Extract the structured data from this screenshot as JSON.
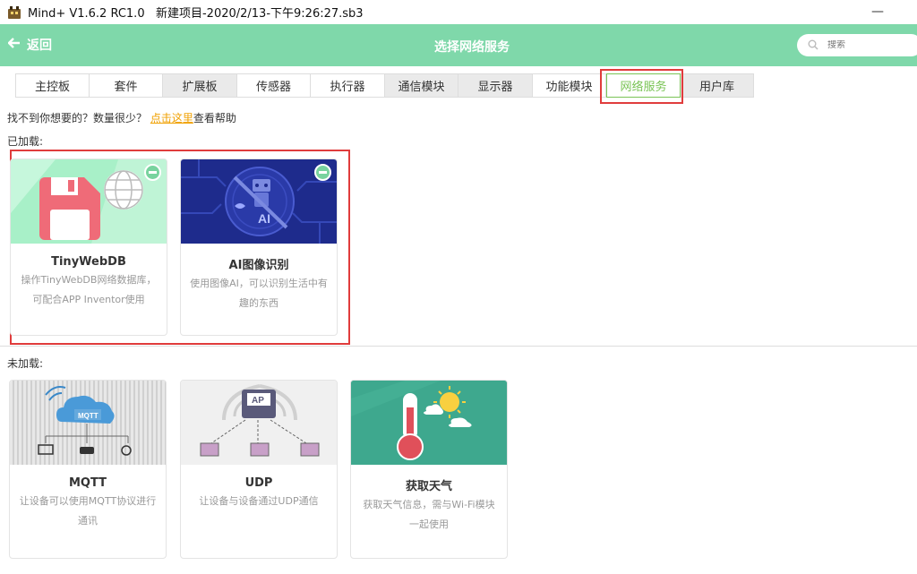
{
  "window": {
    "title": "Mind+ V1.6.2 RC1.0   新建项目-2020/2/13-下午9:26:27.sb3",
    "minimize": "—"
  },
  "header": {
    "back_label": "返回",
    "title": "选择网络服务",
    "search_placeholder": "搜索"
  },
  "tabs": [
    {
      "label": "主控板",
      "state": "normal"
    },
    {
      "label": "套件",
      "state": "normal"
    },
    {
      "label": "扩展板",
      "state": "grey"
    },
    {
      "label": "传感器",
      "state": "normal"
    },
    {
      "label": "执行器",
      "state": "normal"
    },
    {
      "label": "通信模块",
      "state": "grey"
    },
    {
      "label": "显示器",
      "state": "grey"
    },
    {
      "label": "功能模块",
      "state": "normal"
    },
    {
      "label": "网络服务",
      "state": "active"
    },
    {
      "label": "用户库",
      "state": "grey"
    }
  ],
  "help": {
    "prefix": "找不到你想要的？数量很少？",
    "link": "点击这里",
    "suffix": "查看帮助"
  },
  "sections": {
    "loaded": "已加载:",
    "unloaded": "未加载:"
  },
  "loaded_cards": [
    {
      "title": "TinyWebDB",
      "desc": "操作TinyWebDB网络数据库，可配合APP Inventor使用",
      "icon": "floppy-globe-icon"
    },
    {
      "title": "AI图像识别",
      "desc": "使用图像AI，可以识别生活中有趣的东西",
      "icon": "ai-robot-icon",
      "image_text": "AI"
    }
  ],
  "unloaded_cards": [
    {
      "title": "MQTT",
      "desc": "让设备可以使用MQTT协议进行通讯",
      "icon": "mqtt-cloud-icon",
      "image_text": "MQTT"
    },
    {
      "title": "UDP",
      "desc": "让设备与设备通过UDP通信",
      "icon": "udp-network-icon",
      "image_text": "AP"
    },
    {
      "title": "获取天气",
      "desc": "获取天气信息，需与Wi-Fi模块一起使用",
      "icon": "weather-thermometer-icon"
    }
  ],
  "colors": {
    "header_green": "#7fd8aa",
    "active_tab": "#7ac456",
    "highlight_red": "#e03c3c",
    "link_orange": "#f0a000"
  }
}
